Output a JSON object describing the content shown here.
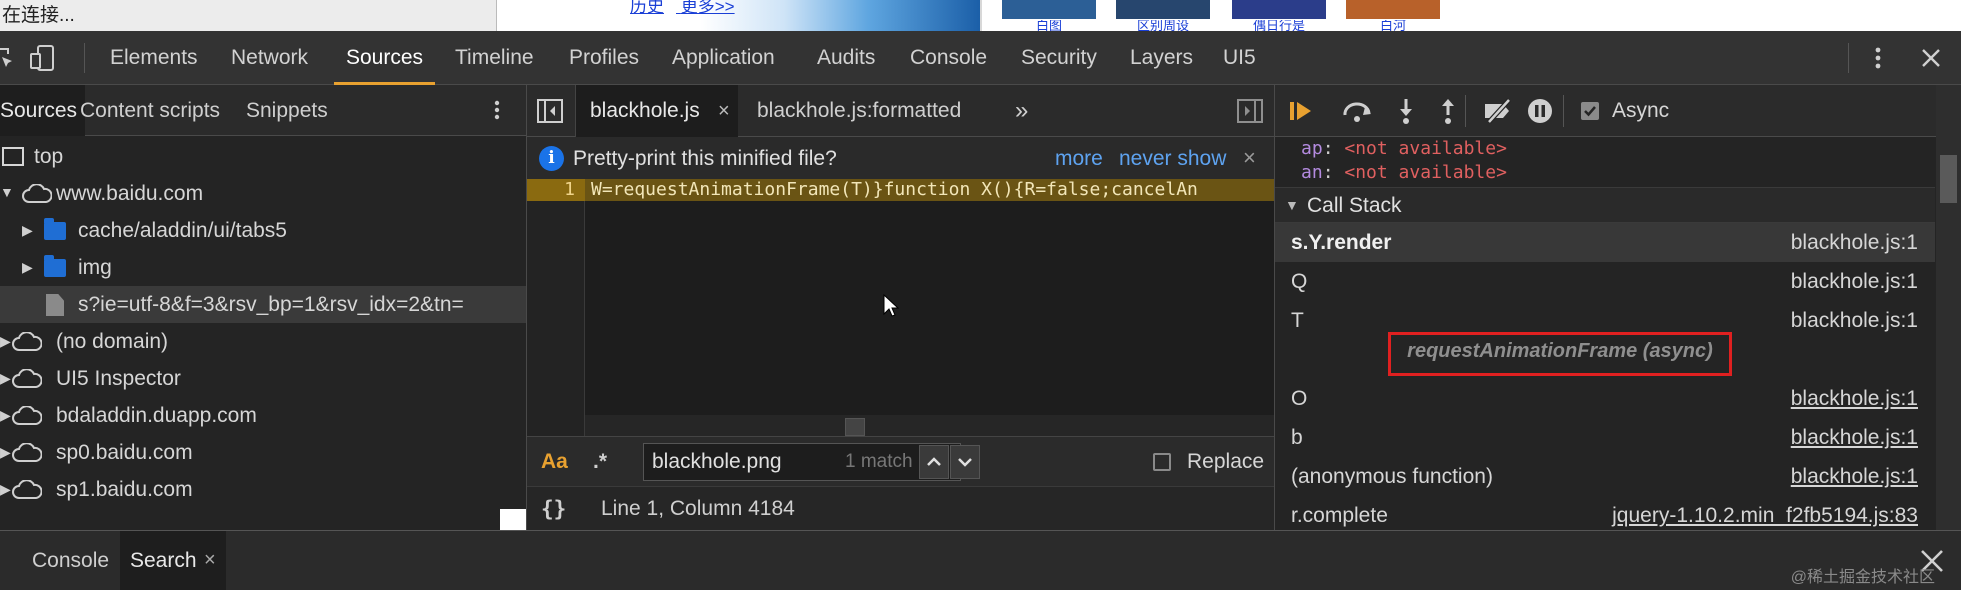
{
  "browser": {
    "status_text": "在连接...",
    "banner_links": [
      "历史",
      "更多>>"
    ],
    "thumb_captions": [
      "白图",
      "区别周设",
      "偶日行是",
      "白河"
    ],
    "thumb_colors": [
      "#2c5f96",
      "#27466e",
      "#2b3d8a",
      "#b8612a"
    ]
  },
  "toolbar": {
    "tabs": [
      "Elements",
      "Network",
      "Sources",
      "Timeline",
      "Profiles",
      "Application",
      "Audits",
      "Console",
      "Security",
      "Layers",
      "UI5"
    ],
    "active_tab": "Sources",
    "icons": [
      "inspect-icon",
      "device-mode-icon",
      "more-vert-icon",
      "close-icon"
    ]
  },
  "navigator": {
    "tabs": [
      "Sources",
      "Content scripts",
      "Snippets"
    ],
    "active_tab": "Sources",
    "tree": [
      {
        "label": "top",
        "type": "frame",
        "indent": 0
      },
      {
        "label": "www.baidu.com",
        "type": "domain",
        "indent": 0,
        "expanded": true
      },
      {
        "label": "cache/aladdin/ui/tabs5",
        "type": "folder",
        "indent": 1
      },
      {
        "label": "img",
        "type": "folder",
        "indent": 1
      },
      {
        "label": "s?ie=utf-8&f=3&rsv_bp=1&rsv_idx=2&tn=",
        "type": "file",
        "indent": 1,
        "selected": true
      },
      {
        "label": "(no domain)",
        "type": "domain",
        "indent": 0
      },
      {
        "label": "UI5 Inspector",
        "type": "domain",
        "indent": 0
      },
      {
        "label": "bdaladdin.duapp.com",
        "type": "domain",
        "indent": 0
      },
      {
        "label": "sp0.baidu.com",
        "type": "domain",
        "indent": 0
      },
      {
        "label": "sp1.baidu.com",
        "type": "domain",
        "indent": 0
      }
    ]
  },
  "editor": {
    "tabs": [
      {
        "label": "blackhole.js",
        "active": true,
        "closable": true
      },
      {
        "label": "blackhole.js:formatted",
        "active": false,
        "closable": false
      }
    ],
    "more_tabs": "»",
    "infobar": {
      "message": "Pretty-print this minified file?",
      "action_more": "more",
      "action_never": "never show",
      "close": "×"
    },
    "line_number": "1",
    "code_line": "W=requestAnimationFrame(T)}function X(){R=false;cancelAn",
    "search": {
      "match_case_label": "Aa",
      "regex_label": ".*",
      "query": "blackhole.png",
      "match_count": "1 match",
      "replace_label": "Replace"
    },
    "status": {
      "braces": "{}",
      "position": "Line 1, Column 4184"
    }
  },
  "debugger": {
    "async_label": "Async",
    "async_checked": true,
    "scope_vars": [
      {
        "name": "ap",
        "value": "<not available>"
      },
      {
        "name": "an",
        "value": "<not available>"
      }
    ],
    "call_stack_title": "Call Stack",
    "frames": [
      {
        "fn": "s.Y.render",
        "loc": "blackhole.js:1",
        "current": true,
        "underline": false
      },
      {
        "fn": "Q",
        "loc": "blackhole.js:1",
        "current": false,
        "underline": false
      },
      {
        "fn": "T",
        "loc": "blackhole.js:1",
        "current": false,
        "underline": false
      },
      {
        "fn": "O",
        "loc": "blackhole.js:1",
        "current": false,
        "underline": true
      },
      {
        "fn": "b",
        "loc": "blackhole.js:1",
        "current": false,
        "underline": true
      },
      {
        "fn": "(anonymous function)",
        "loc": "blackhole.js:1",
        "current": false,
        "underline": true
      },
      {
        "fn": "r.complete",
        "loc": "jquery-1.10.2.min_f2fb5194.js:83",
        "current": false,
        "underline": true
      }
    ],
    "async_divider": "requestAnimationFrame (async)",
    "highlight_color": "#e02020"
  },
  "drawer": {
    "tabs": [
      "Console",
      "Search"
    ],
    "active_tab": "Search",
    "close": "×",
    "watermark": "@稀土掘金技术社区"
  },
  "colors": {
    "accent": "#e8a130",
    "link": "#5ea3f0",
    "scope_name": "#b48be0",
    "scope_value": "#e06060",
    "exec_line": "#8a6a10"
  }
}
